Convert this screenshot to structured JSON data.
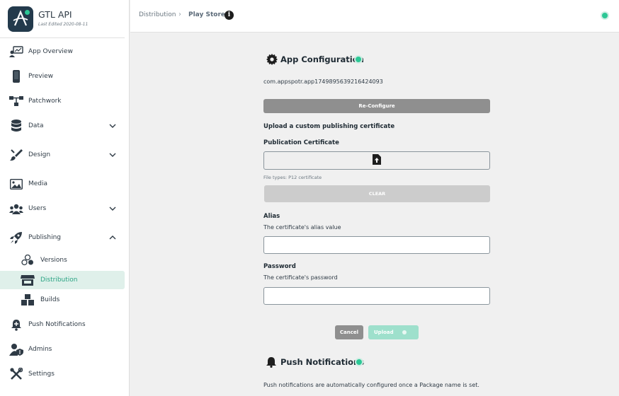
{
  "app": {
    "name": "GTL API",
    "last_edited": "Last Edited 2020-08-11"
  },
  "sidebar": {
    "items": [
      {
        "label": "App Overview",
        "icon": "overview-icon"
      },
      {
        "label": "Preview",
        "icon": "phone-icon"
      },
      {
        "label": "Patchwork",
        "icon": "patchwork-icon"
      },
      {
        "label": "Data",
        "icon": "database-icon"
      },
      {
        "label": "Design",
        "icon": "brush-icon"
      },
      {
        "label": "Media",
        "icon": "image-icon"
      },
      {
        "label": "Users",
        "icon": "users-icon"
      },
      {
        "label": "Publishing",
        "icon": "rocket-icon"
      },
      {
        "label": "Versions",
        "icon": "versions-icon"
      },
      {
        "label": "Distribution",
        "icon": "store-icon"
      },
      {
        "label": "Builds",
        "icon": "boxes-icon"
      },
      {
        "label": "Push Notifications",
        "icon": "push-icon"
      },
      {
        "label": "Admins",
        "icon": "admin-icon"
      },
      {
        "label": "Settings",
        "icon": "tools-icon"
      }
    ]
  },
  "breadcrumb": {
    "parent": "Distribution",
    "current": "Play Store"
  },
  "config": {
    "title": "App Configuration",
    "package_id": "com.appspotr.app1749895639216424093",
    "reconfigure_label": "Re-Configure",
    "upload_custom_label": "Upload a custom publishing certificate",
    "cert_label": "Publication Certificate",
    "file_types": "File types: P12 certificate",
    "clear_label": "CLEAR",
    "alias_label": "Alias",
    "alias_help": "The certificate's alias value",
    "alias_value": "",
    "password_label": "Password",
    "password_help": "The certificate's password",
    "password_value": "",
    "cancel_label": "Cancel",
    "upload_label": "Upload"
  },
  "push": {
    "title": "Push Notifications",
    "description": "Push notifications are automatically configured once a Package name is set."
  },
  "colors": {
    "accent": "#2cc795",
    "active_text": "#29a383",
    "active_bg": "#dff0ea",
    "button_gray": "#8f8f8f",
    "button_disabled": "#cccccc",
    "upload_disabled": "#9ee0cc"
  }
}
